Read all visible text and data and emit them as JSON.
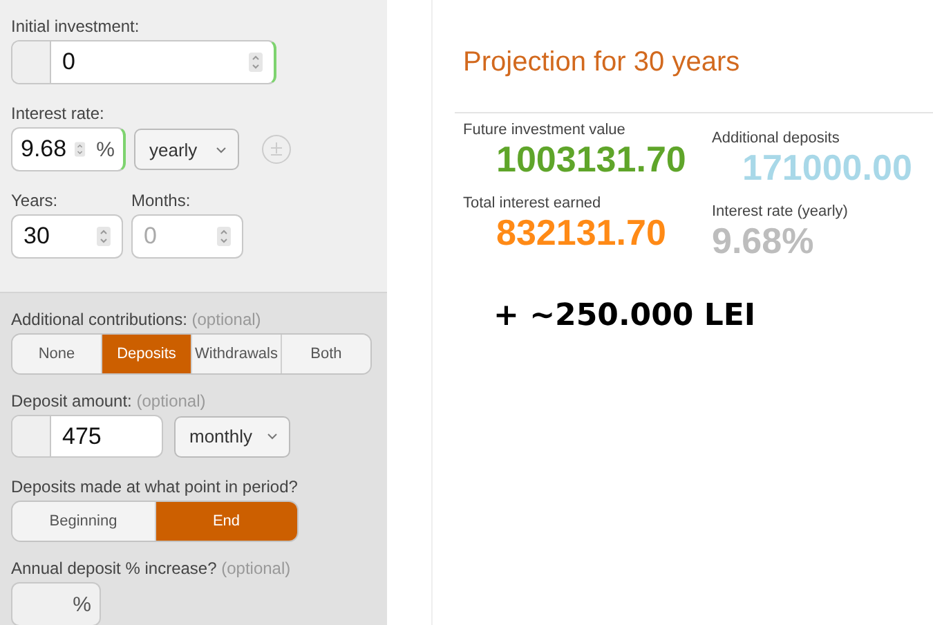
{
  "form": {
    "initial_investment": {
      "label": "Initial investment:",
      "value": "0"
    },
    "interest_rate": {
      "label": "Interest rate:",
      "value": "9.68",
      "unit": "%",
      "period": "yearly"
    },
    "years": {
      "label": "Years:",
      "value": "30"
    },
    "months": {
      "label": "Months:",
      "placeholder": "0"
    },
    "contributions": {
      "label": "Additional contributions:",
      "hint": "(optional)",
      "options": [
        {
          "label": "None",
          "selected": false
        },
        {
          "label": "Deposits",
          "selected": true
        },
        {
          "label": "Withdrawals",
          "selected": false
        },
        {
          "label": "Both",
          "selected": false
        }
      ]
    },
    "deposit_amount": {
      "label": "Deposit amount:",
      "hint": "(optional)",
      "value": "475",
      "period": "monthly"
    },
    "deposit_timing": {
      "label": "Deposits made at what point in period?",
      "options": [
        {
          "label": "Beginning",
          "selected": false
        },
        {
          "label": "End",
          "selected": true
        }
      ]
    },
    "annual_increase": {
      "label": "Annual deposit % increase?",
      "hint": "(optional)",
      "unit": "%"
    }
  },
  "results": {
    "title": "Projection for 30 years",
    "stats": [
      {
        "label": "Future investment value",
        "value": "1003131.70",
        "color": "#5fa52a"
      },
      {
        "label": "Additional deposits",
        "value": "171000.00",
        "color": "#a8d8e8"
      },
      {
        "label": "Total interest earned",
        "value": "832131.70",
        "color": "#ff8a16"
      },
      {
        "label": "Interest rate (yearly)",
        "value": "9.68%",
        "color": "#bdbdbd"
      }
    ],
    "note": "+ ~250.000 LEI"
  }
}
